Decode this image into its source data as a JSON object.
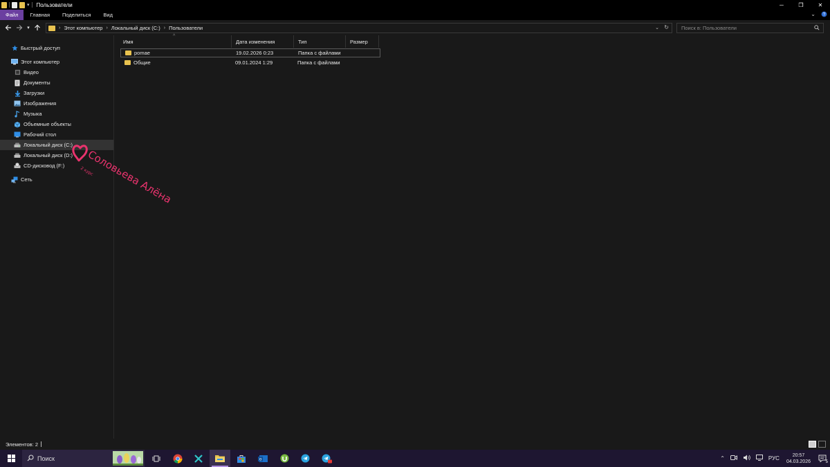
{
  "window": {
    "title": "Пользователи",
    "controls": {
      "minimize": "─",
      "restore": "❐",
      "close": "✕"
    }
  },
  "ribbon": {
    "tabs": [
      "Файл",
      "Главная",
      "Поделиться",
      "Вид"
    ],
    "expand_icon": "chevron-down-icon",
    "help_icon": "help-icon"
  },
  "address_bar": {
    "breadcrumbs": [
      "Этот компьютер",
      "Локальный диск (C:)",
      "Пользователи"
    ]
  },
  "search": {
    "placeholder": "Поиск в: Пользователи"
  },
  "nav_pane": {
    "items": [
      {
        "label": "Быстрый доступ",
        "icon": "star-icon"
      },
      {
        "label": "Этот компьютер",
        "icon": "computer-icon"
      },
      {
        "label": "Видео",
        "icon": "video-icon"
      },
      {
        "label": "Документы",
        "icon": "document-icon"
      },
      {
        "label": "Загрузки",
        "icon": "download-icon"
      },
      {
        "label": "Изображения",
        "icon": "image-icon"
      },
      {
        "label": "Музыка",
        "icon": "music-icon"
      },
      {
        "label": "Объемные объекты",
        "icon": "cube-icon"
      },
      {
        "label": "Рабочий стол",
        "icon": "desktop-icon"
      },
      {
        "label": "Локальный диск (C:)",
        "icon": "drive-icon"
      },
      {
        "label": "Локальный диск (D:)",
        "icon": "drive-icon"
      },
      {
        "label": "CD-дисковод (F:)",
        "icon": "cd-drive-icon"
      },
      {
        "label": "Сеть",
        "icon": "network-icon"
      }
    ]
  },
  "file_list": {
    "columns": [
      "Имя",
      "Дата изменения",
      "Тип",
      "Размер"
    ],
    "rows": [
      {
        "name": "pomae",
        "date": "19.02.2026 0:23",
        "type": "Папка с файлами",
        "size": ""
      },
      {
        "name": "Общие",
        "date": "09.01.2024 1:29",
        "type": "Папка с файлами",
        "size": ""
      }
    ]
  },
  "status_bar": {
    "item_count": "Элементов: 2"
  },
  "watermark": {
    "name": "Соловьева Алёна",
    "subtitle": "2 курс",
    "color": "#e8336d"
  },
  "taskbar": {
    "search_label": "Поиск",
    "apps": [
      "task-view-icon",
      "chrome-icon",
      "x-app-icon",
      "file-explorer-icon",
      "store-icon",
      "mail-icon",
      "utorrent-icon",
      "telegram-icon",
      "telegram-badge-icon"
    ],
    "tray": {
      "lang": "РУС",
      "time": "20:57",
      "date": "04.03.2026",
      "notifications": "5"
    }
  },
  "colors": {
    "accent": "#6b3fa0",
    "background": "#191919",
    "taskbar": "#1e1631",
    "folder": "#e8c24f"
  }
}
